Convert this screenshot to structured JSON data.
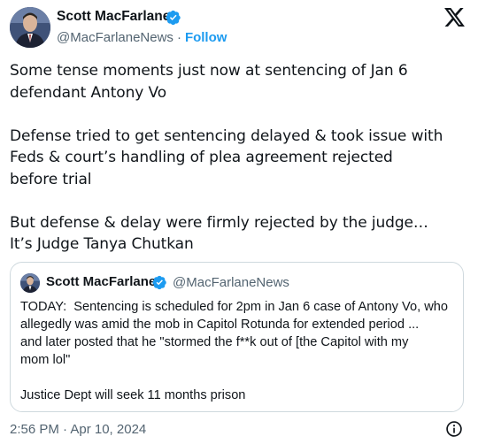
{
  "author": {
    "name": "Scott MacFarlane",
    "handle": "@MacFarlaneNews",
    "separator": "·",
    "follow_label": "Follow"
  },
  "tweet": {
    "text": "Some tense moments just now at sentencing of Jan 6\ndefendant Antony Vo\n\nDefense tried to get sentencing delayed & took issue with\nFeds & court’s handling of plea agreement rejected\nbefore trial\n\nBut defense & delay were firmly rejected by the judge…\nIt’s Judge Tanya Chutkan",
    "timestamp": "2:56 PM · Apr 10, 2024"
  },
  "quoted_tweet": {
    "name": "Scott MacFarlane",
    "handle": "@MacFarlaneNews",
    "text": "TODAY:  Sentencing is scheduled for 2pm in Jan 6 case of Antony Vo, who\nallegedly was amid the mob in Capitol Rotunda for extended period ...\nand later posted that he \"stormed the f**k out of [the Capitol with my\nmom lol\"\n\nJustice Dept will seek 11 months prison"
  },
  "icons": {
    "verified": "verified-badge-icon",
    "brand": "x-logo-icon",
    "info": "info-icon"
  },
  "colors": {
    "text": "#0f1419",
    "secondary": "#536471",
    "accent": "#1d9bf0",
    "border": "#cfd9de"
  }
}
